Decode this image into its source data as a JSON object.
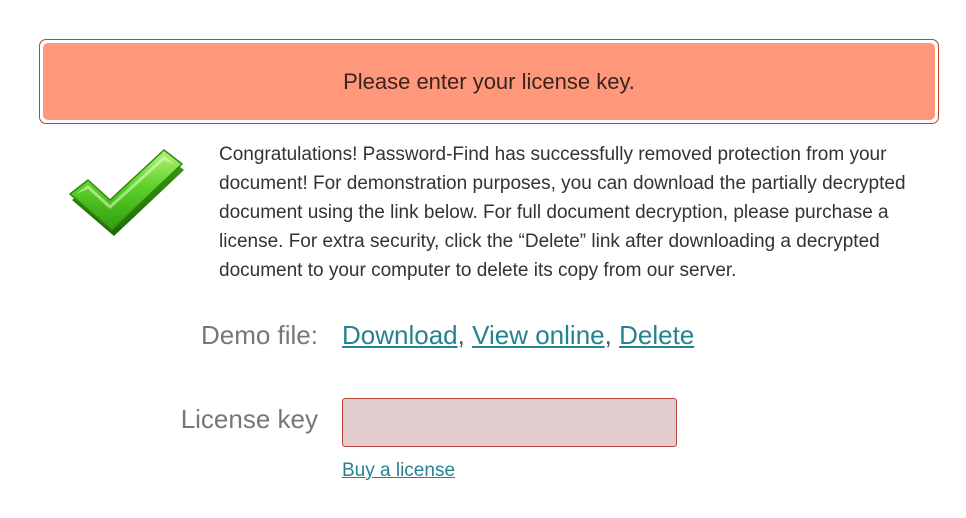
{
  "alert": {
    "message": "Please enter your license key."
  },
  "result": {
    "message": "Congratulations! Password-Find has successfully removed protection from your document! For demonstration purposes, you can download the partially decrypted document using the link below. For full document decryption, please purchase a license. For extra security, click the “Delete” link after downloading a decrypted document to your computer to delete its copy from our server."
  },
  "demo": {
    "label": "Demo file:",
    "download_label": "Download",
    "view_online_label": "View online",
    "delete_label": "Delete",
    "separator": ","
  },
  "license": {
    "label": "License key",
    "value": "",
    "buy_label": "Buy a license"
  },
  "icons": {
    "success": "checkmark-icon"
  },
  "colors": {
    "alert_background": "#ff977a",
    "alert_border": "#b4472d",
    "link": "#25838f",
    "input_background": "#e4cdd0",
    "input_border": "#b5453b",
    "check_green": "#3fae12"
  }
}
